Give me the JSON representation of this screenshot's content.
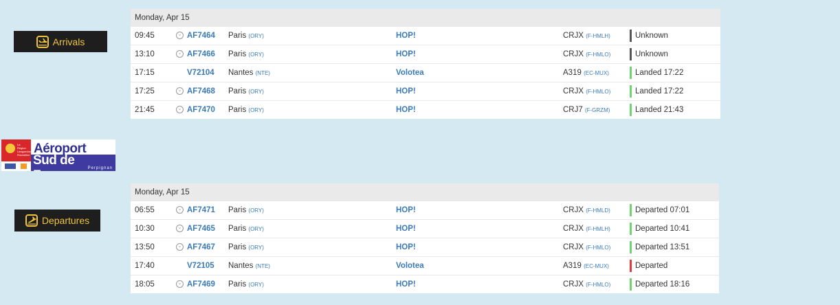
{
  "arrivals": {
    "label": "Arrivals",
    "date": "Monday, Apr 15",
    "rows": [
      {
        "time": "09:45",
        "codeshare": true,
        "flight": "AF7464",
        "city": "Paris",
        "city_code": "(ORY)",
        "airline": "HOP!",
        "aircraft": "CRJX",
        "reg": "(F-HMLH)",
        "status": "Unknown",
        "status_color": "#555555"
      },
      {
        "time": "13:10",
        "codeshare": true,
        "flight": "AF7466",
        "city": "Paris",
        "city_code": "(ORY)",
        "airline": "HOP!",
        "aircraft": "CRJX",
        "reg": "(F-HMLO)",
        "status": "Unknown",
        "status_color": "#555555"
      },
      {
        "time": "17:15",
        "codeshare": false,
        "flight": "V72104",
        "city": "Nantes",
        "city_code": "(NTE)",
        "airline": "Volotea",
        "aircraft": "A319",
        "reg": "(EC-MUX)",
        "status": "Landed 17:22",
        "status_color": "#6fd46f"
      },
      {
        "time": "17:25",
        "codeshare": true,
        "flight": "AF7468",
        "city": "Paris",
        "city_code": "(ORY)",
        "airline": "HOP!",
        "aircraft": "CRJX",
        "reg": "(F-HMLO)",
        "status": "Landed 17:22",
        "status_color": "#6fd46f"
      },
      {
        "time": "21:45",
        "codeshare": true,
        "flight": "AF7470",
        "city": "Paris",
        "city_code": "(ORY)",
        "airline": "HOP!",
        "aircraft": "CRJ7",
        "reg": "(F-GRZM)",
        "status": "Landed 21:43",
        "status_color": "#6fd46f"
      }
    ]
  },
  "logo": {
    "line1": "Aéroport",
    "line2": "Sud de France",
    "line3": "Perpignan",
    "small_text": "La Région Languedoc Roussillon"
  },
  "departures": {
    "label": "Departures",
    "date": "Monday, Apr 15",
    "rows": [
      {
        "time": "06:55",
        "codeshare": true,
        "flight": "AF7471",
        "city": "Paris",
        "city_code": "(ORY)",
        "airline": "HOP!",
        "aircraft": "CRJX",
        "reg": "(F-HMLD)",
        "status": "Departed 07:01",
        "status_color": "#6fd46f"
      },
      {
        "time": "10:30",
        "codeshare": true,
        "flight": "AF7465",
        "city": "Paris",
        "city_code": "(ORY)",
        "airline": "HOP!",
        "aircraft": "CRJX",
        "reg": "(F-HMLH)",
        "status": "Departed 10:41",
        "status_color": "#6fd46f"
      },
      {
        "time": "13:50",
        "codeshare": true,
        "flight": "AF7467",
        "city": "Paris",
        "city_code": "(ORY)",
        "airline": "HOP!",
        "aircraft": "CRJX",
        "reg": "(F-HMLO)",
        "status": "Departed 13:51",
        "status_color": "#6fd46f"
      },
      {
        "time": "17:40",
        "codeshare": false,
        "flight": "V72105",
        "city": "Nantes",
        "city_code": "(NTE)",
        "airline": "Volotea",
        "aircraft": "A319",
        "reg": "(EC-MUX)",
        "status": "Departed",
        "status_color": "#e03a3a"
      },
      {
        "time": "18:05",
        "codeshare": true,
        "flight": "AF7469",
        "city": "Paris",
        "city_code": "(ORY)",
        "airline": "HOP!",
        "aircraft": "CRJX",
        "reg": "(F-HMLO)",
        "status": "Departed 18:16",
        "status_color": "#6fd46f"
      }
    ]
  },
  "icons": {
    "arrivals": "plane-landing-icon",
    "departures": "plane-takeoff-icon",
    "codeshare": "chevron-down-circle-icon"
  }
}
